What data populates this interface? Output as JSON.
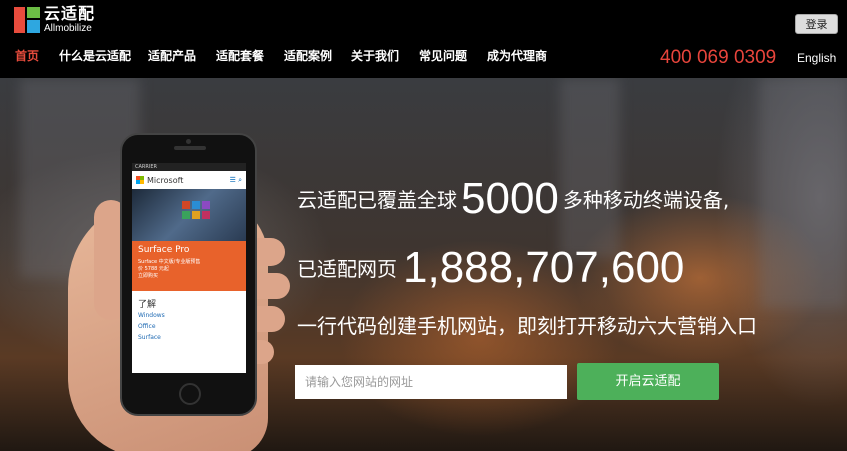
{
  "brand": {
    "name_cn": "云适配",
    "name_en": "Allmobilize",
    "colors": {
      "red": "#e84c3d",
      "green": "#6cbd45",
      "blue": "#2ea7e0"
    }
  },
  "header": {
    "login_label": "登录",
    "phone": "400 069 0309",
    "language": "English",
    "nav": [
      {
        "label": "首页",
        "active": true
      },
      {
        "label": "什么是云适配",
        "active": false
      },
      {
        "label": "适配产品",
        "active": false
      },
      {
        "label": "适配套餐",
        "active": false
      },
      {
        "label": "适配案例",
        "active": false
      },
      {
        "label": "关于我们",
        "active": false
      },
      {
        "label": "常见问题",
        "active": false
      },
      {
        "label": "成为代理商",
        "active": false
      }
    ]
  },
  "hero": {
    "line1_prefix": "云适配已覆盖全球",
    "line1_number": "5000",
    "line1_suffix": "多种移动终端设备,",
    "line2_prefix": "已适配网页",
    "line2_number": "1,888,707,600",
    "line3": "一行代码创建手机网站，即刻打开移动六大营销入口",
    "input_placeholder": "请输入您网站的网址",
    "cta_label": "开启云适配",
    "cta_color": "#4db05a"
  },
  "phone_screen": {
    "carrier": "CARRIER",
    "site": "Microsoft",
    "card_title": "Surface Pro",
    "card_line1": "Surface 中文版/专业版预售",
    "card_line2": "价 5788 元起",
    "card_line3": "立即购买",
    "section_title": "了解",
    "links": [
      "Windows",
      "Office",
      "Surface"
    ]
  }
}
